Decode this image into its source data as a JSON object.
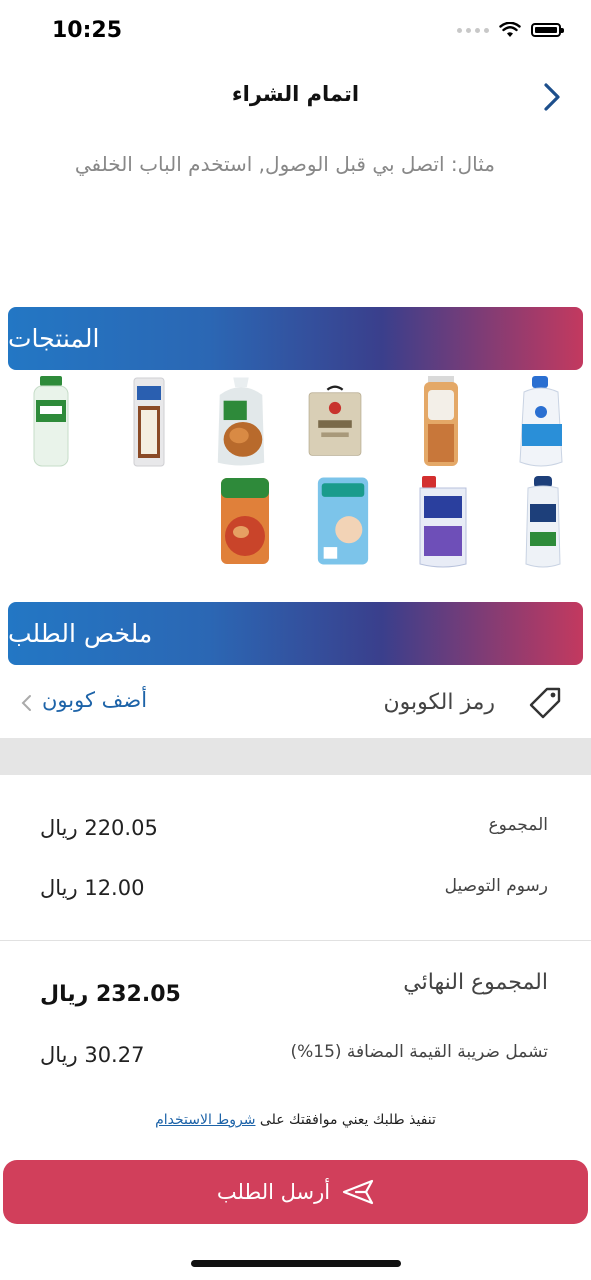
{
  "status_bar": {
    "time": "10:25"
  },
  "header": {
    "title": "اتمام الشراء"
  },
  "note": {
    "text": "مثال: اتصل بي قبل الوصول, استخدم الباب الخلفي"
  },
  "products_section": {
    "title": "المنتجات",
    "items": [
      {
        "name": "milk-bottle-icon",
        "color": "#2a6fd1"
      },
      {
        "name": "bread-icon",
        "color": "#c8773a"
      },
      {
        "name": "rice-bag-icon",
        "color": "#c9bfa6"
      },
      {
        "name": "chicken-icon",
        "color": "#a35c22"
      },
      {
        "name": "ice-cream-sandwich-icon",
        "color": "#6b3a1e"
      },
      {
        "name": "dettol-bottle-icon",
        "color": "#2e8b3a"
      },
      {
        "name": "shampoo-bottle-icon",
        "color": "#1d3f7a"
      },
      {
        "name": "dac-bottle-icon",
        "color": "#2a3f9e"
      },
      {
        "name": "pampers-pack-icon",
        "color": "#4aa8d8"
      },
      {
        "name": "foul-can-icon",
        "color": "#d2542a"
      }
    ]
  },
  "summary_section": {
    "title": "ملخص الطلب"
  },
  "coupon": {
    "label": "رمز الكوبون",
    "action": "أضف كوبون"
  },
  "totals": {
    "subtotal_label": "المجموع",
    "subtotal_value": "220.05 ريال",
    "delivery_label": "رسوم التوصيل",
    "delivery_value": "12.00 ريال",
    "final_label": "المجموع النهائي",
    "final_value": "232.05 ريال",
    "vat_label": "تشمل ضريبة القيمة المضافة (15%)",
    "vat_value": "30.27 ريال"
  },
  "terms": {
    "text": "تنفيذ طلبك يعني موافقتك على",
    "link": "شروط الاستخدام"
  },
  "submit": {
    "label": "أرسل الطلب"
  },
  "colors": {
    "accent_red": "#d13f5b",
    "accent_blue": "#2377c4",
    "link": "#1d63a8"
  }
}
